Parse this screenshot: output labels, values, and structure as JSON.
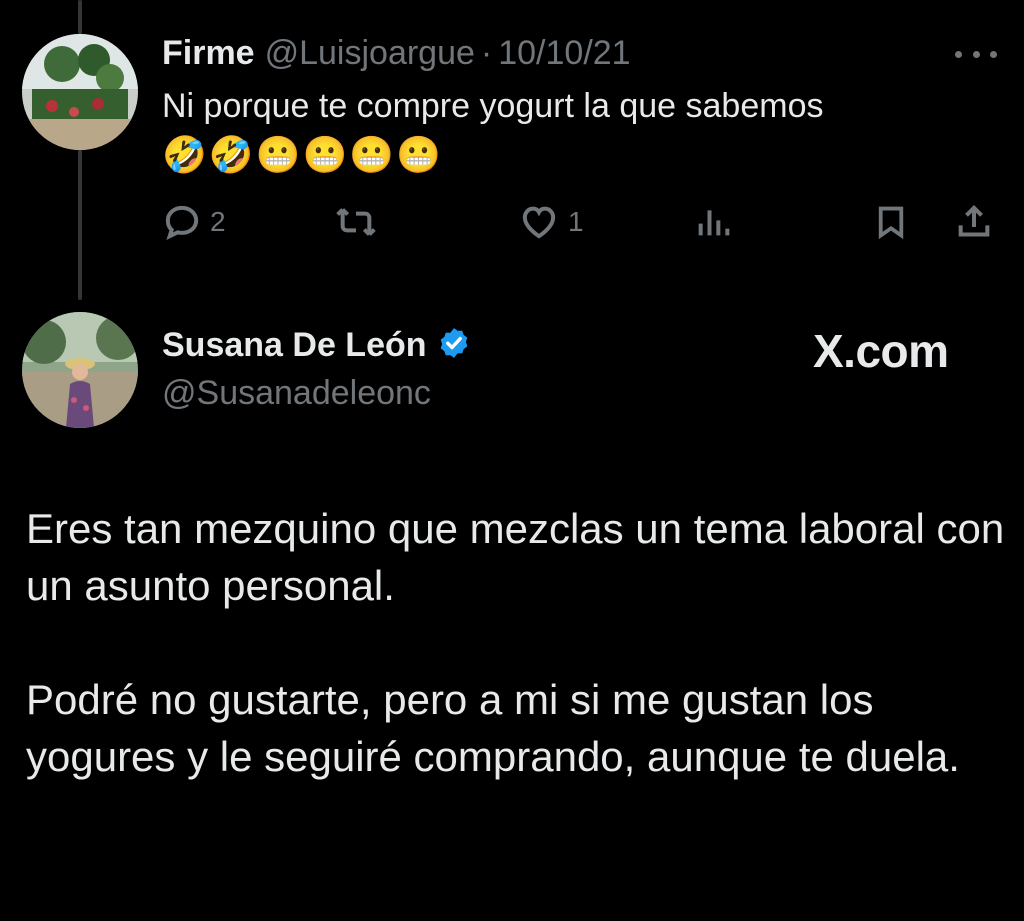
{
  "tweet1": {
    "author_name": "Firme",
    "handle": "@Luisjoargue",
    "separator": "·",
    "date": "10/10/21",
    "text": "Ni porque te compre yogurt  la que sabemos",
    "emojis": "🤣🤣😬😬😬😬",
    "actions": {
      "reply_count": "2",
      "retweet_count": "",
      "like_count": "1"
    },
    "icons": [
      "reply-icon",
      "retweet-icon",
      "heart-icon",
      "views-icon",
      "bookmark-icon",
      "share-icon",
      "more-icon"
    ]
  },
  "tweet2": {
    "author_name": "Susana De León",
    "handle": "@Susanadeleonc",
    "brand": "X.com",
    "paragraphs": [
      "Eres tan mezquino que mezclas un tema laboral con un asunto personal.",
      "Podré no gustarte, pero a mi si me gustan los yogures y le seguiré comprando, aunque te duela."
    ]
  },
  "colors": {
    "background": "#000000",
    "text": "#e7e9ea",
    "muted": "#71767b",
    "verified": "#1d9bf0",
    "thread_line": "#333639"
  }
}
